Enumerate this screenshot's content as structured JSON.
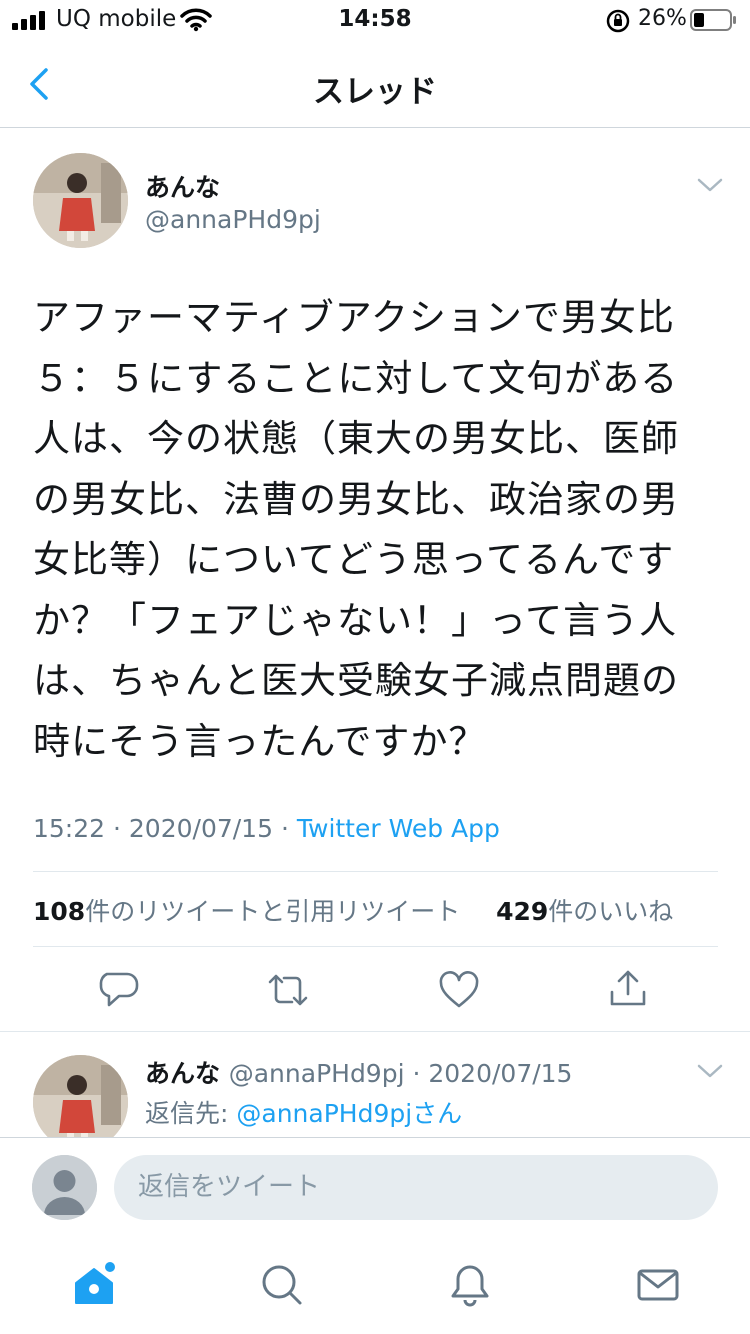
{
  "status_bar": {
    "carrier": "UQ mobile",
    "time": "14:58",
    "battery": "26%",
    "icons": [
      "signal-icon",
      "wifi-icon",
      "orientation-lock-icon",
      "battery-icon"
    ]
  },
  "nav": {
    "title": "スレッド",
    "back_icon": "chevron-left-icon"
  },
  "tweet": {
    "name": "あんな",
    "handle": "@annaPHd9pj",
    "text_lines": [
      "アファーマティブアクションで男女比",
      "５：５にすることに対して文句がある",
      "人は、今の状態（東大の男女比、医師",
      "の男女比、法曹の男女比、政治家の男",
      "女比等）についてどう思ってるんです",
      "か？「フェアじゃない！」って言う人",
      "は、ちゃんと医大受験女子減点問題の",
      "時にそう言ったんですか？"
    ],
    "time": "15:22",
    "date": "2020/07/15",
    "source": "Twitter Web App",
    "retweet_count": "108",
    "retweet_label": "件のリツイートと引用リツイート",
    "like_count": "429",
    "like_label": "件のいいね",
    "actions": [
      "reply-icon",
      "retweet-icon",
      "like-icon",
      "share-icon"
    ]
  },
  "reply": {
    "name": "あんな",
    "handle_date": "@annaPHd9pj · 2020/07/15",
    "reply_to_label": "返信先: ",
    "reply_to_mention": "@annaPHd9pjさん"
  },
  "compose": {
    "placeholder": "返信をツイート"
  },
  "tabs": [
    "home-icon",
    "search-icon",
    "notifications-icon",
    "messages-icon"
  ],
  "colors": {
    "accent": "#1da1f2",
    "text": "#14171a",
    "secondary": "#657786",
    "divider": "#e1e8ed"
  }
}
